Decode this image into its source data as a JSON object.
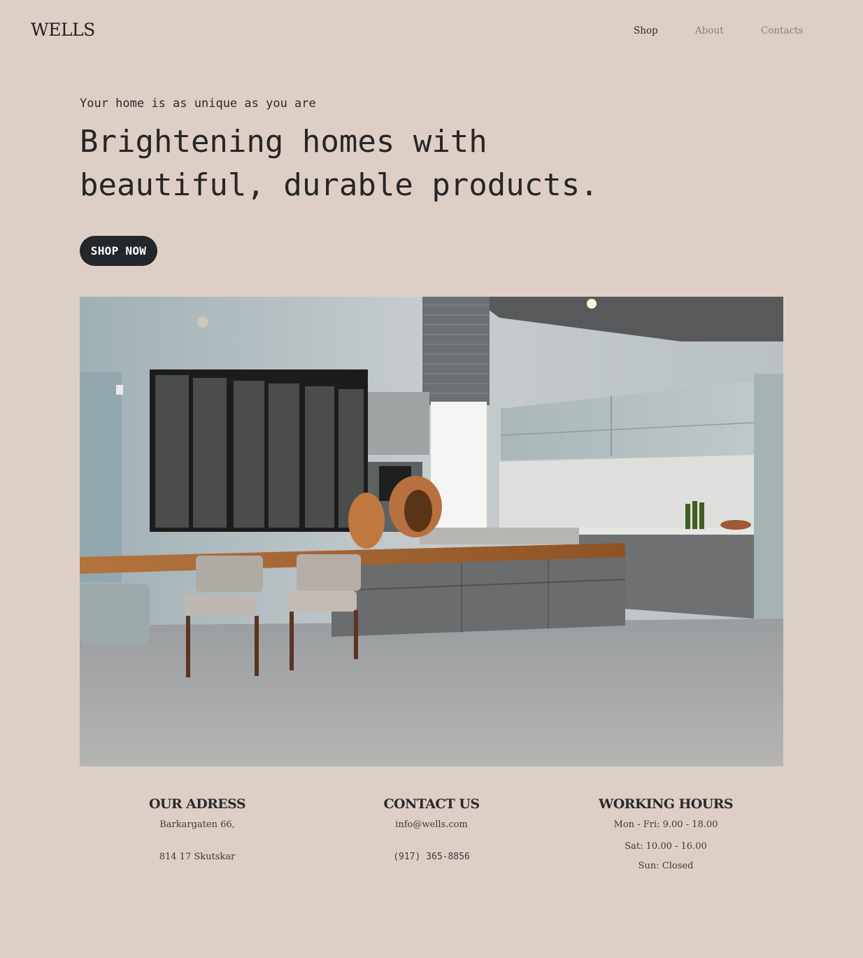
{
  "brand": {
    "logo_text": "WELLS"
  },
  "nav": {
    "items": [
      {
        "label": "Shop",
        "active": true
      },
      {
        "label": "About",
        "active": false
      },
      {
        "label": "Contacts",
        "active": false
      }
    ]
  },
  "hero": {
    "eyebrow": "Your home is as unique as you are",
    "headline_line1": "Brightening homes with",
    "headline_line2": "beautiful, durable products.",
    "cta_label": "SHOP NOW"
  },
  "footer": {
    "address": {
      "title": "OUR ADRESS",
      "line1": "Barkargaten 66,",
      "line2": "814 17 Skutskar"
    },
    "contact": {
      "title": "CONTACT US",
      "email": "info@wells.com",
      "phone": "(917) 365-8856"
    },
    "hours": {
      "title": "WORKING HOURS",
      "weekdays": "Mon - Fri: 9.00 - 18.00",
      "saturday": "Sat: 10.00 - 16.00",
      "sunday": "Sun: Closed"
    }
  },
  "colors": {
    "background": "#decfc6",
    "button": "#23262b",
    "nav_inactive": "#8a7d76"
  }
}
